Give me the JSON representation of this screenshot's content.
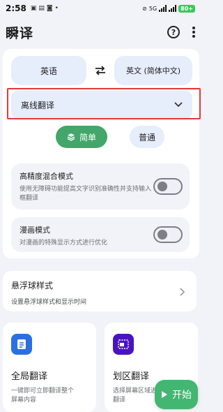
{
  "status": {
    "time": "2:58",
    "left_icons": [
      "bag-icon",
      "doc-icon",
      "chat-icon",
      "dot"
    ],
    "network": "5G",
    "battery": "80+"
  },
  "app": {
    "title": "瞬译",
    "help_glyph": "?"
  },
  "languages": {
    "source": "英语",
    "target": "英文 (简体中文)"
  },
  "mode_select": {
    "value": "离线翻译"
  },
  "segments": {
    "simple": "简单",
    "normal": "普通"
  },
  "options": [
    {
      "title": "高精度混合模式",
      "desc": "使用无障碍功能提高文字识别准确性并支持输入框翻译",
      "on": false
    },
    {
      "title": "漫画模式",
      "desc": "对漫画的特殊显示方式进行优化",
      "on": false
    }
  ],
  "float_ball": {
    "title": "悬浮球样式",
    "desc": "设置悬浮球样式和显示时间"
  },
  "features": {
    "global": {
      "title": "全局翻译",
      "desc": "一键即可立即翻译整个屏幕内容"
    },
    "region": {
      "title": "划区翻译",
      "desc": "选择屏幕区域进行精确翻译"
    }
  },
  "fab": {
    "label": "开始"
  },
  "colors": {
    "accent_green": "#43a66a",
    "chip_blue": "#e6edfb",
    "global_icon": "#2b6fe5",
    "region_icon": "#4a13c2",
    "highlight_red": "#e53935"
  }
}
